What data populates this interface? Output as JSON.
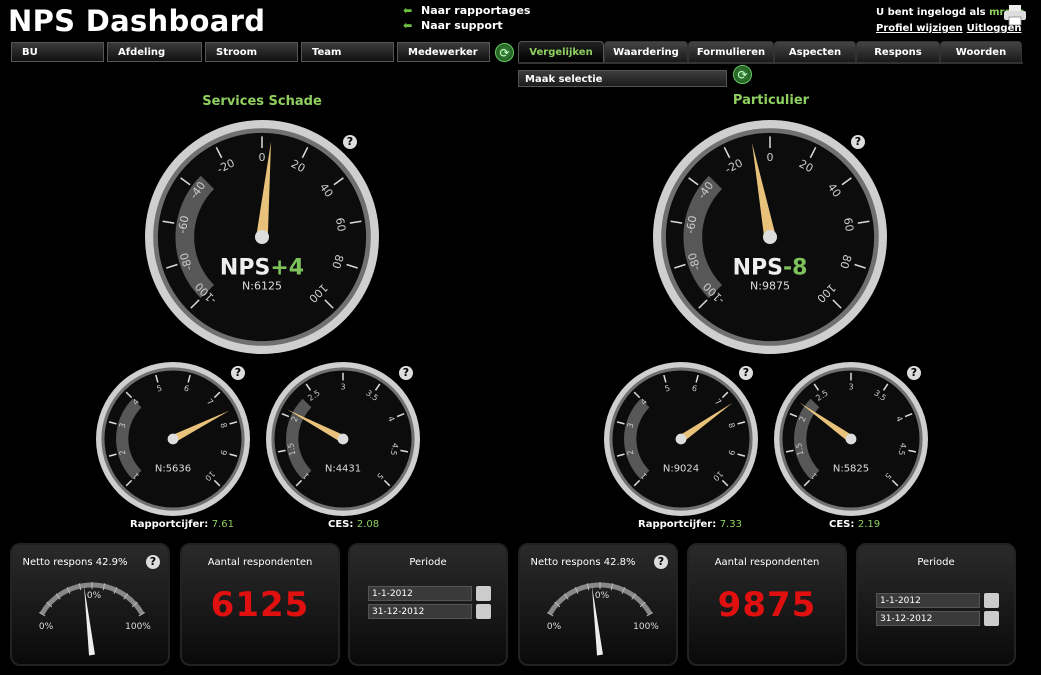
{
  "header": {
    "title": "NPS Dashboard",
    "links": [
      "Naar rapportages",
      "Naar support"
    ],
    "login_prefix": "U bent ingelogd als",
    "username": "mrosb",
    "profile_link": "Profiel wijzigen",
    "logout_link": "Uitloggen"
  },
  "filters": [
    "BU",
    "Afdeling",
    "Stroom",
    "Team",
    "Medewerker"
  ],
  "tabs": [
    "Vergelijken",
    "Waardering",
    "Formulieren",
    "Aspecten",
    "Respons",
    "Woorden"
  ],
  "active_tab": "Vergelijken",
  "selection_placeholder": "Maak selectie",
  "colors": {
    "accent_green": "#8fd060",
    "number_red": "#e01010",
    "nps_green": "#7dc25a"
  },
  "left": {
    "title": "Services Schade",
    "nps": {
      "label": "NPS",
      "value": "+4",
      "n": "N:6125",
      "value_num": 4,
      "ticks": [
        "-100",
        "-80",
        "-60",
        "-40",
        "-20",
        "0",
        "20",
        "40",
        "60",
        "80",
        "100"
      ]
    },
    "rapport": {
      "caption": "Rapportcijfer:",
      "value": "7.61",
      "n": "N:5636",
      "value_num": 7.61,
      "ticks": [
        "1",
        "2",
        "3",
        "4",
        "5",
        "6",
        "7",
        "8",
        "9",
        "10"
      ]
    },
    "ces": {
      "caption": "CES:",
      "value": "2.08",
      "n": "N:4431",
      "value_num": 2.08,
      "ticks": [
        "1",
        "1.5",
        "2",
        "2.5",
        "3",
        "3.5",
        "4",
        "4.5",
        "5"
      ]
    },
    "netto": {
      "title": "Netto respons 42.9%",
      "min": "0%",
      "mid": "0%",
      "max": "100%",
      "value_pct": 42.9
    },
    "respondenten": {
      "title": "Aantal respondenten",
      "value": "6125"
    },
    "periode": {
      "title": "Periode",
      "start": "1-1-2012",
      "end": "31-12-2012"
    }
  },
  "right": {
    "title": "Particulier",
    "nps": {
      "label": "NPS",
      "value": "-8",
      "n": "N:9875",
      "value_num": -8,
      "ticks": [
        "-100",
        "-80",
        "-60",
        "-40",
        "-20",
        "0",
        "20",
        "40",
        "60",
        "80",
        "100"
      ]
    },
    "rapport": {
      "caption": "Rapportcijfer:",
      "value": "7.33",
      "n": "N:9024",
      "value_num": 7.33,
      "ticks": [
        "1",
        "2",
        "3",
        "4",
        "5",
        "6",
        "7",
        "8",
        "9",
        "10"
      ]
    },
    "ces": {
      "caption": "CES:",
      "value": "2.19",
      "n": "N:5825",
      "value_num": 2.19,
      "ticks": [
        "1",
        "1.5",
        "2",
        "2.5",
        "3",
        "3.5",
        "4",
        "4.5",
        "5"
      ]
    },
    "netto": {
      "title": "Netto respons 42.8%",
      "min": "0%",
      "mid": "0%",
      "max": "100%",
      "value_pct": 42.8
    },
    "respondenten": {
      "title": "Aantal respondenten",
      "value": "9875"
    },
    "periode": {
      "title": "Periode",
      "start": "1-1-2012",
      "end": "31-12-2012"
    }
  }
}
